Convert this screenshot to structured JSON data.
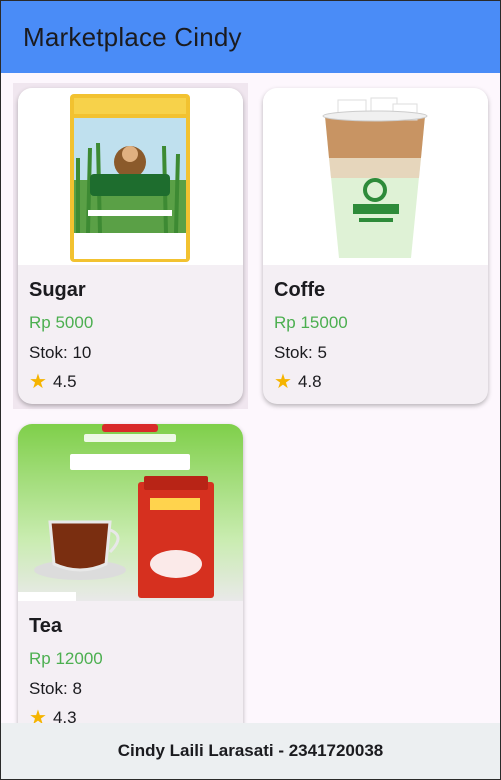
{
  "appbar": {
    "title": "Marketplace Cindy",
    "color": "#4a8cf7"
  },
  "products": [
    {
      "name": "Sugar",
      "price": "Rp 5000",
      "stock": "Stok: 10",
      "rating": "4.5",
      "image": "gulaku-sugar-bag"
    },
    {
      "name": "Coffe",
      "price": "Rp 15000",
      "stock": "Stok: 5",
      "rating": "4.8",
      "image": "iced-latte-cup"
    },
    {
      "name": "Tea",
      "price": "Rp 12000",
      "stock": "Stok: 8",
      "rating": "4.3",
      "image": "black-tea-box"
    }
  ],
  "footer": {
    "text": "Cindy Laili Larasati - 2341720038"
  },
  "colors": {
    "price": "#4caf50",
    "star": "#f5b400",
    "footer_bg": "#eceff1"
  }
}
